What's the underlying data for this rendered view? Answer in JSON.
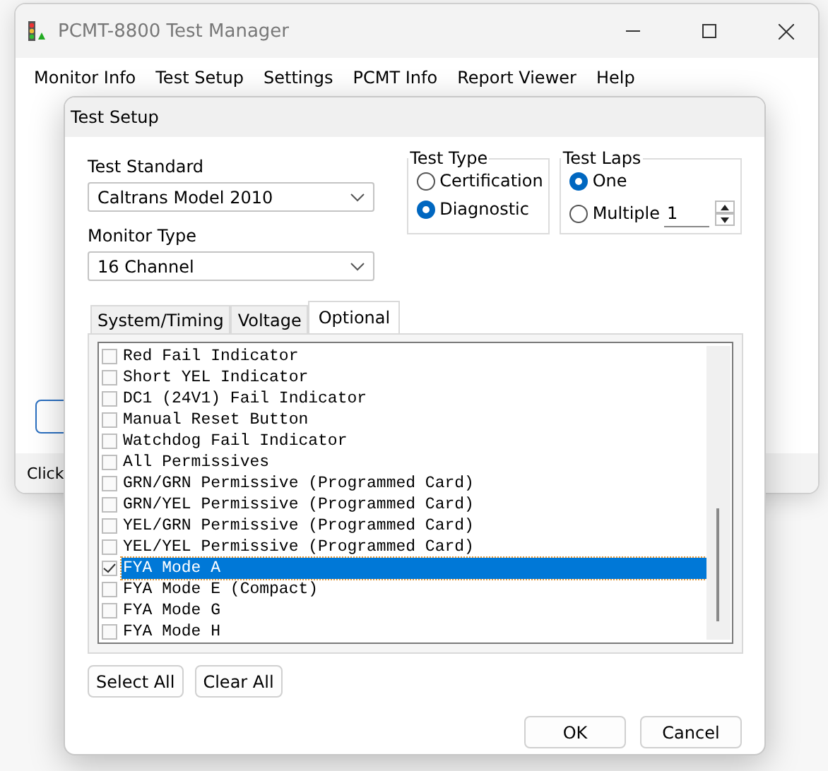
{
  "main_window": {
    "title": "PCMT-8800 Test Manager",
    "menu": [
      "Monitor Info",
      "Test Setup",
      "Settings",
      "PCMT Info",
      "Report Viewer",
      "Help"
    ],
    "status_text": "Click"
  },
  "dialog": {
    "title": "Test Setup",
    "test_standard": {
      "label": "Test Standard",
      "value": "Caltrans Model 2010"
    },
    "monitor_type": {
      "label": "Monitor Type",
      "value": "16 Channel"
    },
    "test_type": {
      "label": "Test Type",
      "options": [
        {
          "label": "Certification",
          "selected": false
        },
        {
          "label": "Diagnostic",
          "selected": true
        }
      ]
    },
    "test_laps": {
      "label": "Test Laps",
      "options": [
        {
          "label": "One",
          "selected": true
        },
        {
          "label": "Multiple",
          "selected": false
        }
      ],
      "count": "1"
    },
    "tabs": [
      {
        "label": "System/Timing",
        "selected": false
      },
      {
        "label": "Voltage",
        "selected": false
      },
      {
        "label": "Optional",
        "selected": true
      }
    ],
    "items": [
      {
        "label": "Red Fail Indicator",
        "checked": false,
        "selected": false
      },
      {
        "label": "Short YEL Indicator",
        "checked": false,
        "selected": false
      },
      {
        "label": "DC1 (24V1) Fail Indicator",
        "checked": false,
        "selected": false
      },
      {
        "label": "Manual Reset Button",
        "checked": false,
        "selected": false
      },
      {
        "label": "Watchdog Fail Indicator",
        "checked": false,
        "selected": false
      },
      {
        "label": "All Permissives",
        "checked": false,
        "selected": false
      },
      {
        "label": "GRN/GRN Permissive (Programmed Card)",
        "checked": false,
        "selected": false
      },
      {
        "label": "GRN/YEL Permissive (Programmed Card)",
        "checked": false,
        "selected": false
      },
      {
        "label": "YEL/GRN Permissive (Programmed Card)",
        "checked": false,
        "selected": false
      },
      {
        "label": "YEL/YEL Permissive (Programmed Card)",
        "checked": false,
        "selected": false
      },
      {
        "label": "FYA Mode A",
        "checked": true,
        "selected": true
      },
      {
        "label": "FYA Mode E (Compact)",
        "checked": false,
        "selected": false
      },
      {
        "label": "FYA Mode G",
        "checked": false,
        "selected": false
      },
      {
        "label": "FYA Mode H",
        "checked": false,
        "selected": false
      }
    ],
    "list_buttons": [
      "Select All",
      "Clear All"
    ],
    "buttons": [
      "OK",
      "Cancel"
    ]
  }
}
